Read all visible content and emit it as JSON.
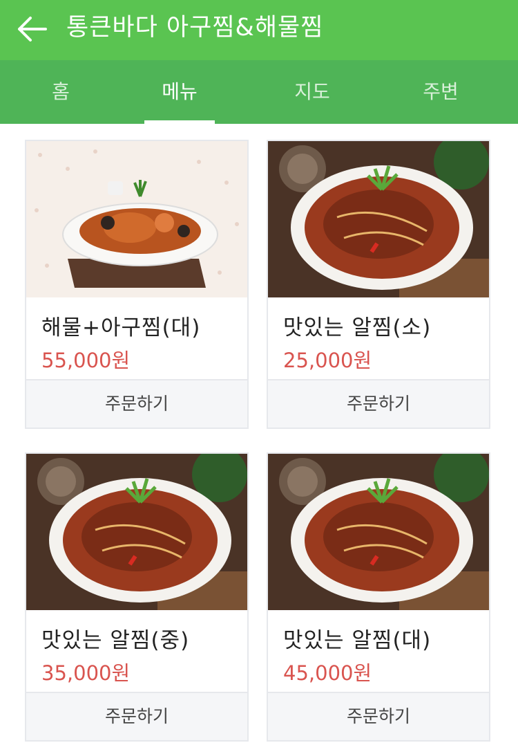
{
  "header": {
    "title": "통큰바다 아구찜&해물찜"
  },
  "tabs": [
    {
      "label": "홈",
      "active": false
    },
    {
      "label": "메뉴",
      "active": true
    },
    {
      "label": "지도",
      "active": false
    },
    {
      "label": "주변",
      "active": false
    }
  ],
  "menu": [
    {
      "name": "해물+아구찜(대)",
      "price": "55,000원",
      "order_label": "주문하기"
    },
    {
      "name": "맛있는 알찜(소)",
      "price": "25,000원",
      "order_label": "주문하기"
    },
    {
      "name": "맛있는 알찜(중)",
      "price": "35,000원",
      "order_label": "주문하기"
    },
    {
      "name": "맛있는 알찜(대)",
      "price": "45,000원",
      "order_label": "주문하기"
    }
  ],
  "colors": {
    "header": "#5ac451",
    "tabs": "#4fb457",
    "price": "#d9544f"
  }
}
